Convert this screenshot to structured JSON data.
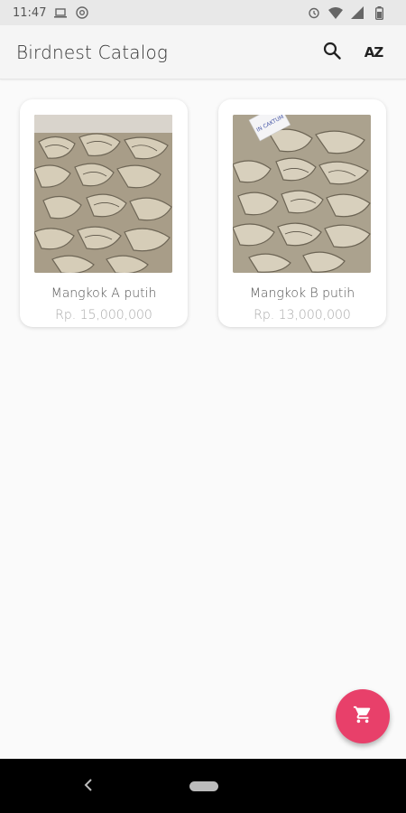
{
  "status_bar": {
    "time": "11:47"
  },
  "app_bar": {
    "title": "Birdnest Catalog",
    "sort_label": "AZ"
  },
  "products": [
    {
      "name": "Mangkok A putih",
      "price": "Rp. 15,000,000"
    },
    {
      "name": "Mangkok B putih",
      "price": "Rp. 13,000,000",
      "tag_text": "IN CAKTUM"
    }
  ],
  "colors": {
    "fab": "#e8406a",
    "background": "#fafafa",
    "app_bar": "#f5f5f5"
  },
  "icons": {
    "search": "search-icon",
    "sort": "sort-az-icon",
    "cart": "cart-icon",
    "back": "back-icon"
  }
}
